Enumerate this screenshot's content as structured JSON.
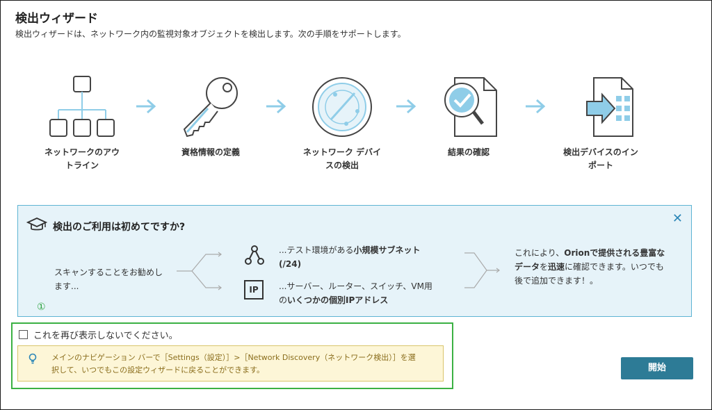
{
  "header": {
    "title": "検出ウィザード",
    "subtitle": "検出ウィザードは、ネットワーク内の監視対象オブジェクトを検出します。次の手順をサポートします。"
  },
  "steps": [
    {
      "icon": "network-outline-icon",
      "label_line1": "ネットワークのアウ",
      "label_line2": "トライン"
    },
    {
      "icon": "key-icon",
      "label_line1": "資格情報の定義",
      "label_line2": ""
    },
    {
      "icon": "radar-icon",
      "label_line1": "ネットワーク デバイ",
      "label_line2": "スの検出"
    },
    {
      "icon": "document-magnifier-icon",
      "label_line1": "結果の確認",
      "label_line2": ""
    },
    {
      "icon": "import-icon",
      "label_line1": "検出デバイスのイン",
      "label_line2": "ポート"
    }
  ],
  "tips": {
    "title": "検出のご利用は初めてですか?",
    "left_line1": "スキャンすることをお勧めし",
    "left_line2": "ます...",
    "item1_line1_pre": "...テスト環境がある",
    "item1_line1_bold": "小規模サブネット",
    "item1_line2_bold": "(/24)",
    "item2_line1": "...サーバー、ルーター、スイッチ、VM用",
    "item2_line2_pre": "の",
    "item2_line2_bold": "いくつかの個別IPアドレス",
    "ip_label": "IP",
    "right_line1_pre": "これにより、",
    "right_line1_bold": "Orionで提供される豊富な",
    "right_line2_bold1": "データ",
    "right_line2_mid1": "を",
    "right_line2_bold2": "迅速",
    "right_line2_rest": "に確認できます。いつでも",
    "right_line3": "後で追加できます！。",
    "close": "✕"
  },
  "annotation": {
    "number": "①"
  },
  "dont_show": {
    "label": "これを再び表示しないでください。",
    "checked": false
  },
  "hint": {
    "line1": "メインのナビゲーション バーで［Settings（設定）］>［Network Discovery（ネットワーク検出）］を選",
    "line2": "択して、いつでもこの設定ウィザードに戻ることができます。"
  },
  "actions": {
    "start": "開始"
  },
  "colors": {
    "accent_blue": "#2d7b96",
    "icon_blue": "#8fcde8",
    "tips_bg": "#e6f3f9",
    "tips_border": "#5db4d3",
    "hint_bg": "#fdf6d7",
    "hint_text": "#8a6d1c",
    "annotation_green": "#3bb143"
  }
}
